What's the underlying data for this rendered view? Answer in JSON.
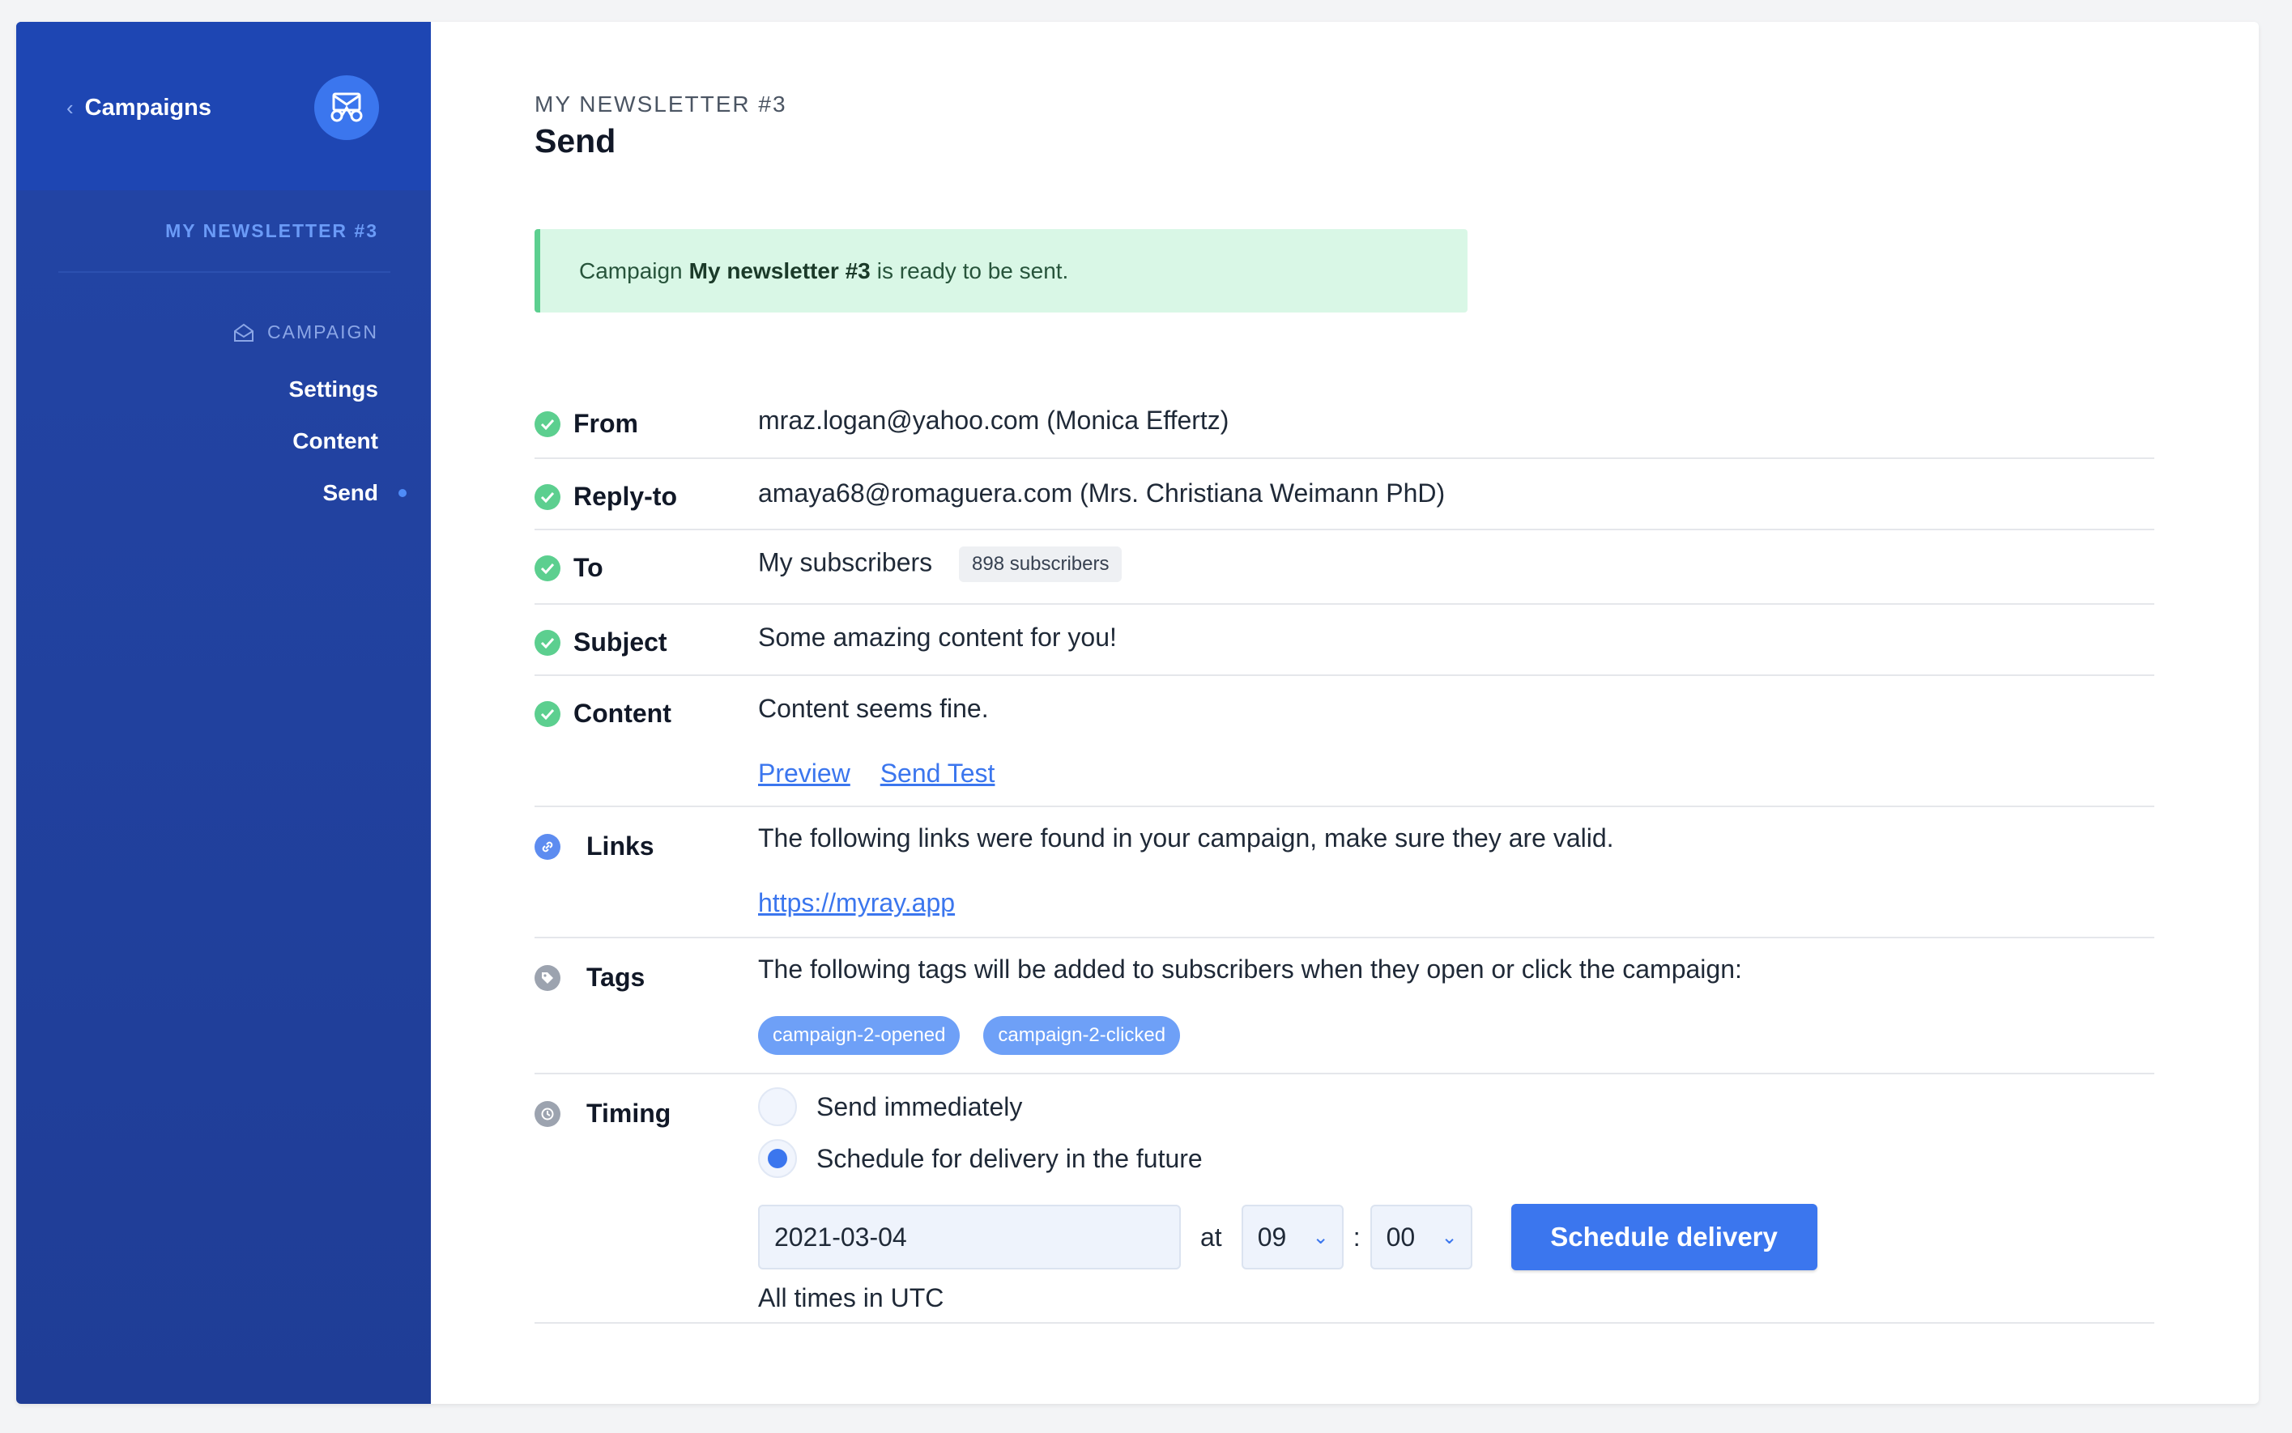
{
  "sidebar": {
    "back_label": "Campaigns",
    "newsletter_name": "MY NEWSLETTER #3",
    "section_label": "CAMPAIGN",
    "items": [
      {
        "label": "Settings"
      },
      {
        "label": "Content"
      },
      {
        "label": "Send",
        "active": true
      }
    ]
  },
  "header": {
    "kicker": "MY NEWSLETTER #3",
    "title": "Send"
  },
  "alert": {
    "prefix": "Campaign",
    "campaign_name": "My newsletter #3",
    "suffix": "is ready to be sent."
  },
  "summary": {
    "from": {
      "label": "From",
      "value": "mraz.logan@yahoo.com (Monica Effertz)"
    },
    "reply_to": {
      "label": "Reply-to",
      "value": "amaya68@romaguera.com (Mrs. Christiana Weimann PhD)"
    },
    "to": {
      "label": "To",
      "value": "My subscribers",
      "badge": "898 subscribers"
    },
    "subject": {
      "label": "Subject",
      "value": "Some amazing content for you!"
    },
    "content": {
      "label": "Content",
      "value": "Content seems fine.",
      "preview_link": "Preview",
      "send_test_link": "Send Test"
    },
    "links": {
      "label": "Links",
      "value": "The following links were found in your campaign, make sure they are valid.",
      "urls": [
        "https://myray.app"
      ]
    },
    "tags": {
      "label": "Tags",
      "value": "The following tags will be added to subscribers when they open or click the campaign:",
      "items": [
        "campaign-2-opened",
        "campaign-2-clicked"
      ]
    }
  },
  "timing": {
    "label": "Timing",
    "option_immediate": "Send immediately",
    "option_schedule": "Schedule for delivery in the future",
    "selected": "schedule",
    "date": "2021-03-04",
    "at_label": "at",
    "hour": "09",
    "minute_separator": ":",
    "minute": "00",
    "button_label": "Schedule delivery",
    "hint": "All times in UTC"
  },
  "colors": {
    "sidebar": "#1f3d96",
    "accent": "#3b76ee",
    "success": "#5ccf8f",
    "alert_bg": "#d9f7e6"
  }
}
